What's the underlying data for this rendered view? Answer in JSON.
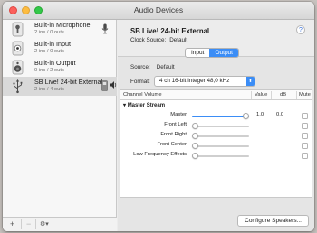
{
  "window": {
    "title": "Audio Devices"
  },
  "sidebar": {
    "devices": [
      {
        "name": "Built-in Microphone",
        "channels": "2 ins / 0 outs"
      },
      {
        "name": "Built-in Input",
        "channels": "2 ins / 0 outs"
      },
      {
        "name": "Built-in Output",
        "channels": "0 ins / 2 outs"
      },
      {
        "name": "SB Live! 24-bit External",
        "channels": "2 ins / 4 outs"
      }
    ],
    "add_label": "+",
    "remove_label": "−",
    "gear_label": "⚙▾"
  },
  "detail": {
    "device_name": "SB Live! 24-bit External",
    "help_label": "?",
    "clock_label": "Clock Source:",
    "clock_value": "Default",
    "tabs": [
      "Input",
      "Output"
    ],
    "active_tab": "Output",
    "source_label": "Source:",
    "source_value": "Default",
    "format_label": "Format:",
    "format_value": "4 ch 16-bit Integer 48,0 kHz",
    "table": {
      "headers": [
        "Channel Volume",
        "Value",
        "dB",
        "Mute"
      ],
      "group": "Master Stream",
      "rows": [
        {
          "channel": "Master",
          "value": "1,0",
          "db": "0,0",
          "level": 1.0
        },
        {
          "channel": "Front Left",
          "value": "",
          "db": "",
          "level": 0
        },
        {
          "channel": "Front Right",
          "value": "",
          "db": "",
          "level": 0
        },
        {
          "channel": "Front Center",
          "value": "",
          "db": "",
          "level": 0
        },
        {
          "channel": "Low Frequency Effects",
          "value": "",
          "db": "",
          "level": 0
        }
      ]
    },
    "configure_label": "Configure Speakers..."
  },
  "colors": {
    "accent": "#3b8df6",
    "selection": "#d9d9d9"
  }
}
